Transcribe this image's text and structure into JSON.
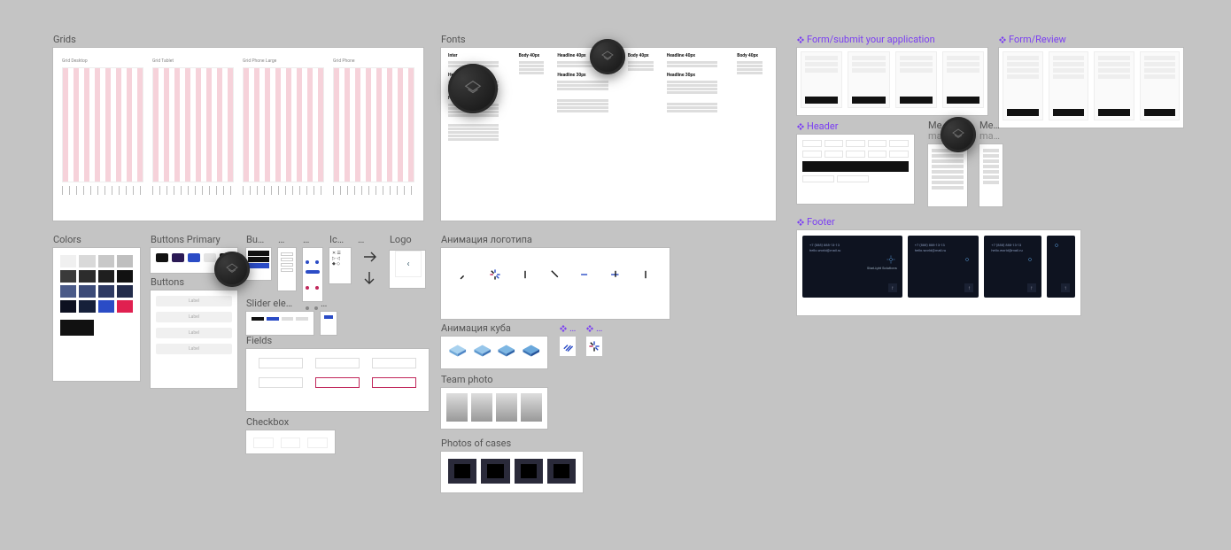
{
  "accent_color": "#7b3ff2",
  "frames": {
    "grids": {
      "label": "Grids",
      "columns": [
        "Grid Desktop",
        "Grid Tablet",
        "Grid Phone Large",
        "Grid Phone"
      ]
    },
    "fonts": {
      "label": "Fonts",
      "sample_title": "Inter",
      "headline_big": "Headline 40px",
      "body": "Body 40px",
      "headline_med": "Headline 30px",
      "headline_sm": "Headline 24px"
    },
    "colors": {
      "label": "Colors",
      "swatches": [
        "#f0f0f0",
        "#d9d9d9",
        "#c8c8c8",
        "#bfbfbf",
        "#3a3a3a",
        "#2c2c2c",
        "#1f1f1f",
        "#111111",
        "#4a5a88",
        "#3c4b78",
        "#2e3a62",
        "#232c4b",
        "#0d1020",
        "#16203a",
        "#2b4cc6",
        "#e02050"
      ]
    },
    "buttons_primary": {
      "label": "Buttons Primary"
    },
    "buttons_secondary": {
      "label": "Bu…"
    },
    "buttons_tertiary": {
      "label": "…"
    },
    "buttons": {
      "label": "Buttons",
      "sample": "Label"
    },
    "icons": {
      "label": "Ic…"
    },
    "icons2": {
      "label": "…"
    },
    "arrows": {
      "label": ""
    },
    "logo": {
      "label": "Logo"
    },
    "slider": {
      "label": "Slider ele…"
    },
    "slider2": {
      "label": "…"
    },
    "fields": {
      "label": "Fields"
    },
    "checkbox": {
      "label": "Checkbox"
    },
    "logo_anim": {
      "label": "Анимация логотипа"
    },
    "cube_anim": {
      "label": "Анимация куба"
    },
    "cube_tiny1": {
      "label": "…"
    },
    "cube_tiny2": {
      "label": "…"
    },
    "team": {
      "label": "Team photo"
    },
    "cases": {
      "label": "Photos of cases"
    },
    "form_submit": {
      "label": "Form/submit your application"
    },
    "form_review": {
      "label": "Form/Review"
    },
    "header": {
      "label": "Header"
    },
    "menu1": {
      "label": "Me…",
      "sub": "main p…"
    },
    "menu2": {
      "label": "Me…",
      "sub": "ma…"
    },
    "footer": {
      "label": "Footer",
      "phone": "+7 (888) 888-13-13",
      "email": "hello.world@mail.ru",
      "brand": "StarLight Solutions"
    }
  }
}
